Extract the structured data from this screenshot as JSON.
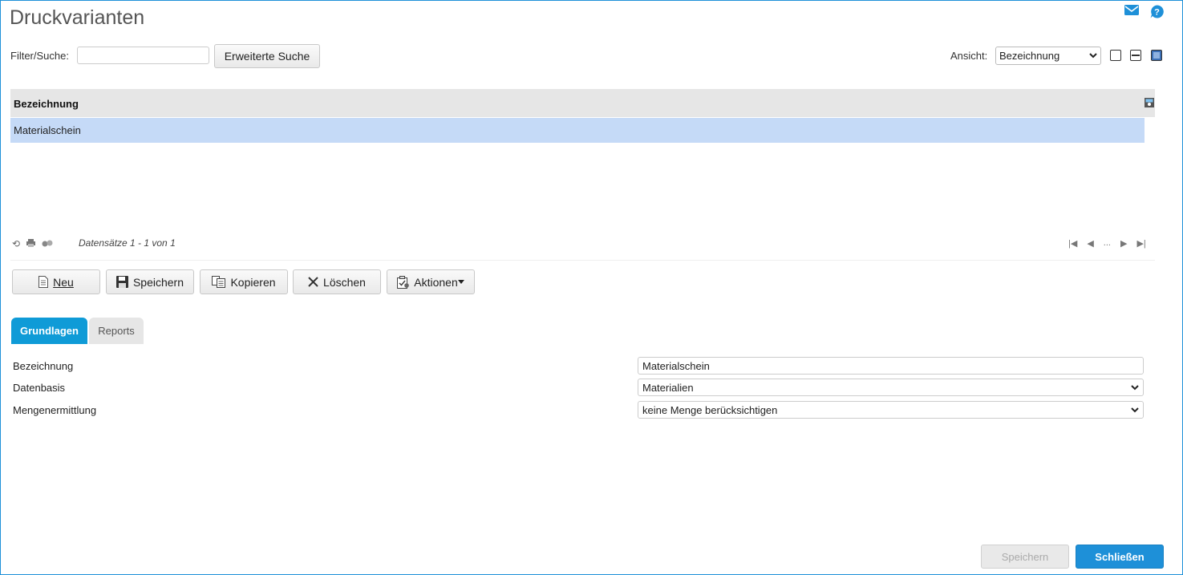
{
  "page": {
    "title": "Druckvarianten"
  },
  "filter": {
    "label": "Filter/Suche:",
    "value": "",
    "advanced_button": "Erweiterte Suche"
  },
  "ansicht": {
    "label": "Ansicht:",
    "selected": "Bezeichnung"
  },
  "grid": {
    "column": "Bezeichnung",
    "rows": [
      "Materialschein"
    ],
    "record_info": "Datensätze 1 - 1 von 1",
    "pager_ellipsis": "..."
  },
  "toolbar": {
    "new": "Neu",
    "save": "Speichern",
    "copy": "Kopieren",
    "delete": "Löschen",
    "actions": "Aktionen"
  },
  "tabs": {
    "active": "Grundlagen",
    "inactive": "Reports"
  },
  "form": {
    "bezeichnung_label": "Bezeichnung",
    "bezeichnung_value": "Materialschein",
    "datenbasis_label": "Datenbasis",
    "datenbasis_value": "Materialien",
    "mengen_label": "Mengenermittlung",
    "mengen_value": "keine Menge berücksichtigen"
  },
  "bottom": {
    "save": "Speichern",
    "close": "Schließen"
  },
  "colors": {
    "accent": "#1e90d8",
    "selected_row": "#c5daf7",
    "tab_active": "#0f9bd7"
  }
}
